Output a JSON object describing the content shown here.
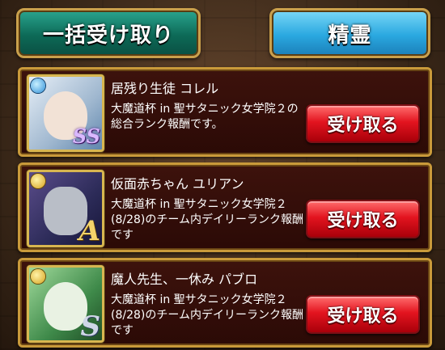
{
  "top_buttons": {
    "bulk_receive": "一括受け取り",
    "spirit": "精霊"
  },
  "rewards": [
    {
      "character": "居残り生徒 コレル",
      "description": "大魔道杯 in 聖サタニック女学院２の総合ランク報酬です。",
      "rank": "SS",
      "button": "受け取る"
    },
    {
      "character": "仮面赤ちゃん ユリアン",
      "description": "大魔道杯 in 聖サタニック女学院２(8/28)のチーム内デイリーランク報酬です",
      "rank": "A",
      "button": "受け取る"
    },
    {
      "character": "魔人先生、一休み パブロ",
      "description": "大魔道杯 in 聖サタニック女学院２(8/28)のチーム内デイリーランク報酬です",
      "rank": "S",
      "button": "受け取る"
    }
  ],
  "colors": {
    "bulk_button": "#0d6a57",
    "spirit_button": "#2aa8e0",
    "receive_button": "#e3141f",
    "card_frame": "#c99a3a"
  }
}
